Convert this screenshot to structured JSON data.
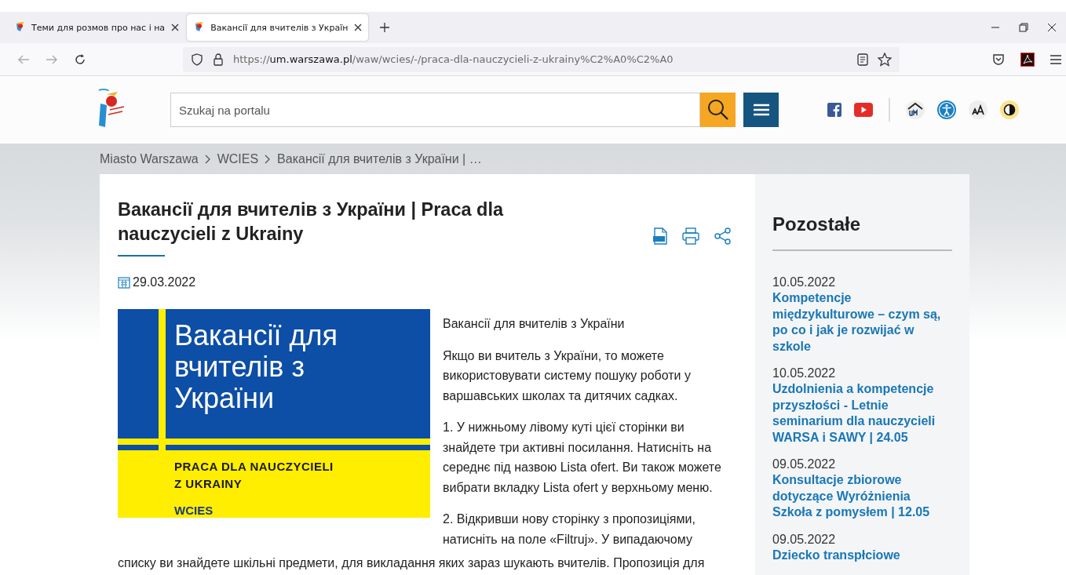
{
  "browser": {
    "tabs": [
      {
        "title": "Теми для розмов про нас і на",
        "selected": false
      },
      {
        "title": "Вакансії для вчителів з Україн",
        "selected": true
      }
    ],
    "url": {
      "scheme": "https://",
      "host": "um.warszawa.pl",
      "path": "/waw/wcies/-/praca-dla-nauczycieli-z-ukrainy%C2%A0%C2%A0"
    }
  },
  "header": {
    "search": {
      "placeholder": "Szukaj na portalu"
    }
  },
  "breadcrumbs": [
    "Miasto Warszawa",
    "WCIES",
    "Вакансії для вчителів з України | …"
  ],
  "article": {
    "title": "Вакансії для вчителів з України | Praca dla nauczycieli z Ukrainy",
    "date": "29.03.2022",
    "banner": {
      "title": "Вакансії для вчителів з України",
      "subtitle_lines": [
        "PRACA DLA NAUCZYCIELI",
        "Z UKRAINY"
      ],
      "brand": "WCIES"
    },
    "paragraphs": [
      "Вакансії для вчителів з України",
      "Якщо ви вчитель з України, то можете використовувати систему пошуку роботи у варшавських школах та дитячих садках.",
      "1. У нижньому лівому куті цієї сторінки ви знайдете три активні посилання. Натисніть на середнє під назвою Lista ofert. Ви також можете вибрати вкладку Lista ofert у верхньому меню.",
      "2. Відкривши нову сторінку з пропозиціями, натисніть на поле «Filtruj». У випадаючому"
    ],
    "continuation": "списку ви знайдете шкільні предмети, для викладання яких зараз шукають вчителів. Пропозиція для"
  },
  "sidebar": {
    "heading": "Pozostałe",
    "items": [
      {
        "date": "10.05.2022",
        "title": "Kompetencje międzykulturowe – czym są, po co i jak je rozwijać w szkole"
      },
      {
        "date": "10.05.2022",
        "title": "Uzdolnienia a kompetencje przyszłości - Letnie seminarium dla nauczycieli WARSA i SAWY | 24.05"
      },
      {
        "date": "09.05.2022",
        "title": "Konsultacje zbiorowe dotyczące Wyróżnienia Szkoła z pomysłem | 12.05"
      },
      {
        "date": "09.05.2022",
        "title": "Dziecko transpłciowe"
      }
    ]
  }
}
